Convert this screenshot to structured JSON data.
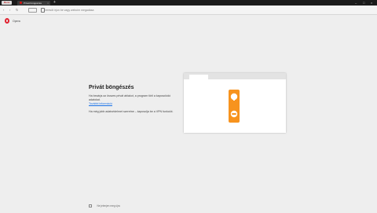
{
  "browser": {
    "menu_label": "Menü",
    "tab": {
      "title": "Privát böngészés",
      "close_glyph": "×"
    },
    "new_tab_glyph": "+",
    "window_controls": [
      "–",
      "□",
      "×"
    ]
  },
  "toolbar": {
    "back_glyph": "‹",
    "forward_glyph": "›",
    "reload_glyph": "↻",
    "address_placeholder": "Keresőt írjon be vagy webcím megadása"
  },
  "logo": {
    "name": "Opera"
  },
  "content": {
    "title": "Privát böngészés",
    "paragraph1": "Ha bezárja az összes privát ablakot, a program törli a kapcsolódó adatokat.",
    "link": "További információ",
    "paragraph2": "Ha még jobb adatvédelmet szeretne – kapcsolja be a VPN funkciót."
  },
  "footer": {
    "checkbox_label": "Ne jelenjen meg újra"
  },
  "colors": {
    "brand": "#e0212f",
    "hanger": "#f7931e",
    "link": "#1a73e8"
  }
}
